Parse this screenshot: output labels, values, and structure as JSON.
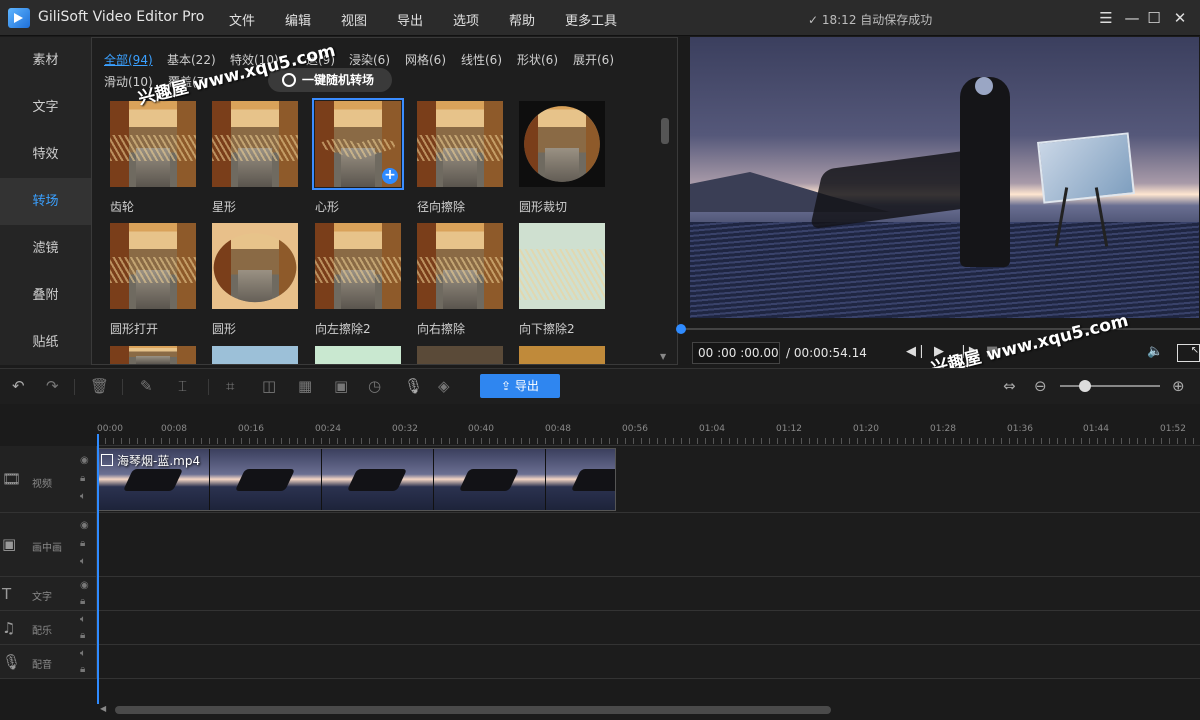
{
  "app": {
    "title": "GiliSoft Video Editor Pro",
    "autosave": "✓ 18:12 自动保存成功"
  },
  "menu": [
    "文件",
    "编辑",
    "视图",
    "导出",
    "选项",
    "帮助",
    "更多工具"
  ],
  "sidebar": {
    "items": [
      {
        "label": "素材"
      },
      {
        "label": "文字"
      },
      {
        "label": "特效"
      },
      {
        "label": "转场",
        "active": true
      },
      {
        "label": "滤镜"
      },
      {
        "label": "叠附"
      },
      {
        "label": "贴纸"
      }
    ]
  },
  "transitions": {
    "categories": [
      "全部(94)",
      "基本(22)",
      "特效(10)",
      "运(9)",
      "浸染(6)",
      "网格(6)",
      "线性(6)",
      "形状(6)",
      "展开(6)",
      "滑动(10)",
      "覆盖(7"
    ],
    "random_button": "一键随机转场",
    "items": [
      {
        "label": "齿轮"
      },
      {
        "label": "星形"
      },
      {
        "label": "心形",
        "selected": true
      },
      {
        "label": "径向擦除"
      },
      {
        "label": "圆形裁切"
      },
      {
        "label": "圆形打开"
      },
      {
        "label": "圆形"
      },
      {
        "label": "向左擦除2"
      },
      {
        "label": "向右擦除"
      },
      {
        "label": "向下擦除2"
      }
    ]
  },
  "watermark": "兴趣屋 www.xqu5.com",
  "player": {
    "current_time": "00 :00 :00.00",
    "total_time": "/ 00:00:54.14",
    "progress": 0.0
  },
  "toolbar": {
    "export_label": "导出",
    "zoom_level": 0.25
  },
  "timeline": {
    "ticks": [
      "00:00",
      "00:08",
      "00:16",
      "00:24",
      "00:32",
      "00:40",
      "00:48",
      "00:56",
      "01:04",
      "01:12",
      "01:20",
      "01:28",
      "01:36",
      "01:44",
      "01:52"
    ],
    "tracks": [
      {
        "label": "视频"
      },
      {
        "label": "画中画"
      },
      {
        "label": "文字"
      },
      {
        "label": "配乐"
      },
      {
        "label": "配音"
      }
    ],
    "clip": {
      "name": "海琴烟-蓝.mp4"
    }
  }
}
